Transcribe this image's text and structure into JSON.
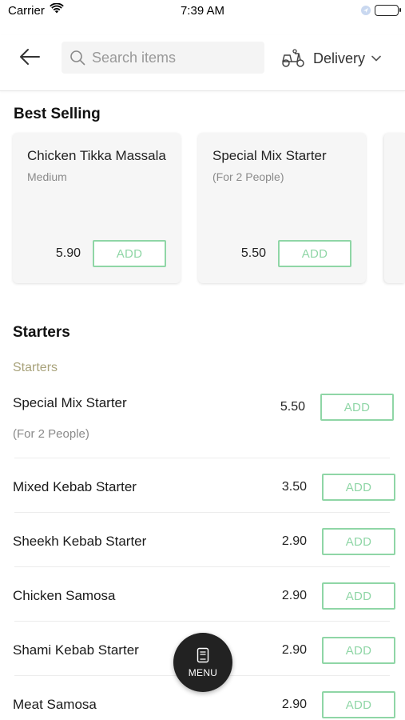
{
  "status_bar": {
    "carrier": "Carrier",
    "time": "7:39 AM"
  },
  "header": {
    "search_placeholder": "Search items",
    "delivery_label": "Delivery"
  },
  "best_selling": {
    "title": "Best Selling",
    "items": [
      {
        "name": "Chicken Tikka Massala",
        "sub": "Medium",
        "price": "5.90",
        "add_label": "ADD"
      },
      {
        "name": "Special Mix Starter",
        "sub": "(For 2 People)",
        "price": "5.50",
        "add_label": "ADD"
      }
    ]
  },
  "starters": {
    "title": "Starters",
    "category_label": "Starters",
    "items": [
      {
        "name": "Special Mix Starter",
        "desc": "(For 2 People)",
        "price": "5.50",
        "add_label": "ADD"
      },
      {
        "name": "Mixed Kebab Starter",
        "price": "3.50",
        "add_label": "ADD"
      },
      {
        "name": "Sheekh Kebab Starter",
        "price": "2.90",
        "add_label": "ADD"
      },
      {
        "name": "Chicken Samosa",
        "price": "2.90",
        "add_label": "ADD"
      },
      {
        "name": "Shami Kebab Starter",
        "price": "2.90",
        "add_label": "ADD"
      },
      {
        "name": "Meat Samosa",
        "price": "2.90",
        "add_label": "ADD"
      }
    ]
  },
  "menu_fab": {
    "label": "MENU"
  },
  "colors": {
    "accent_green": "#8fd6a6",
    "category_label": "#a8a27a",
    "fab_bg": "#222222"
  },
  "icons": [
    "wifi-icon",
    "location-icon",
    "battery-icon",
    "back-arrow-icon",
    "search-icon",
    "scooter-icon",
    "chevron-down-icon",
    "menu-book-icon"
  ]
}
